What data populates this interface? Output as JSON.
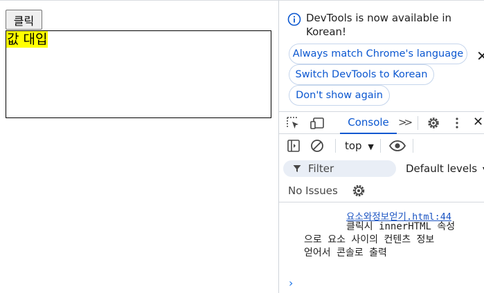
{
  "page": {
    "button_label": "클릭",
    "content_text": "값 대입"
  },
  "devtools": {
    "notice": "DevTools is now available in Korean!",
    "chips": [
      "Always match Chrome's language",
      "Switch DevTools to Korean",
      "Don't show again"
    ],
    "tab_console": "Console",
    "context": "top",
    "filter_placeholder": "Filter",
    "levels": "Default levels",
    "issues": "No Issues",
    "log": {
      "source": "요소와정보얻기.html:44",
      "lines": [
        "클릭시 innerHTML 속성",
        "으로 요소 사이의 컨텐츠 정보",
        "얻어서 콘솔로 출력"
      ]
    },
    "prompt": "›"
  },
  "colors": {
    "accent": "#0b57d0",
    "highlight": "#ffff00"
  }
}
